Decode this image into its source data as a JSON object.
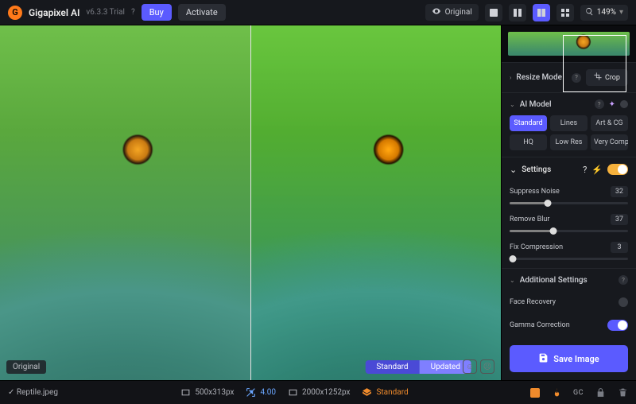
{
  "header": {
    "app_name": "Gigapixel AI",
    "version": "v6.3.3 Trial",
    "help": "?",
    "buy": "Buy",
    "activate": "Activate",
    "original_pill": "Original",
    "zoom": "149%"
  },
  "canvas": {
    "original_label": "Original",
    "compare_a": "Standard",
    "compare_b": "Updated"
  },
  "sidebar": {
    "resize_mode": "Resize Mode",
    "crop": "Crop",
    "ai_model": "AI Model",
    "models": [
      "Standard",
      "Lines",
      "Art & CG",
      "HQ",
      "Low Res",
      "Very Compressed"
    ],
    "active_model_idx": 0,
    "settings": "Settings",
    "sliders": {
      "suppress_noise": {
        "label": "Suppress Noise",
        "value": 32
      },
      "remove_blur": {
        "label": "Remove Blur",
        "value": 37
      },
      "fix_compression": {
        "label": "Fix Compression",
        "value": 3
      }
    },
    "additional": "Additional Settings",
    "face_recovery": "Face Recovery",
    "gamma_correction": "Gamma Correction",
    "save": "Save Image"
  },
  "footer": {
    "filename": "Reptile.jpeg",
    "in_size": "500x313px",
    "scale": "4.00",
    "out_size": "2000x1252px",
    "model": "Standard",
    "gc": "GC"
  }
}
